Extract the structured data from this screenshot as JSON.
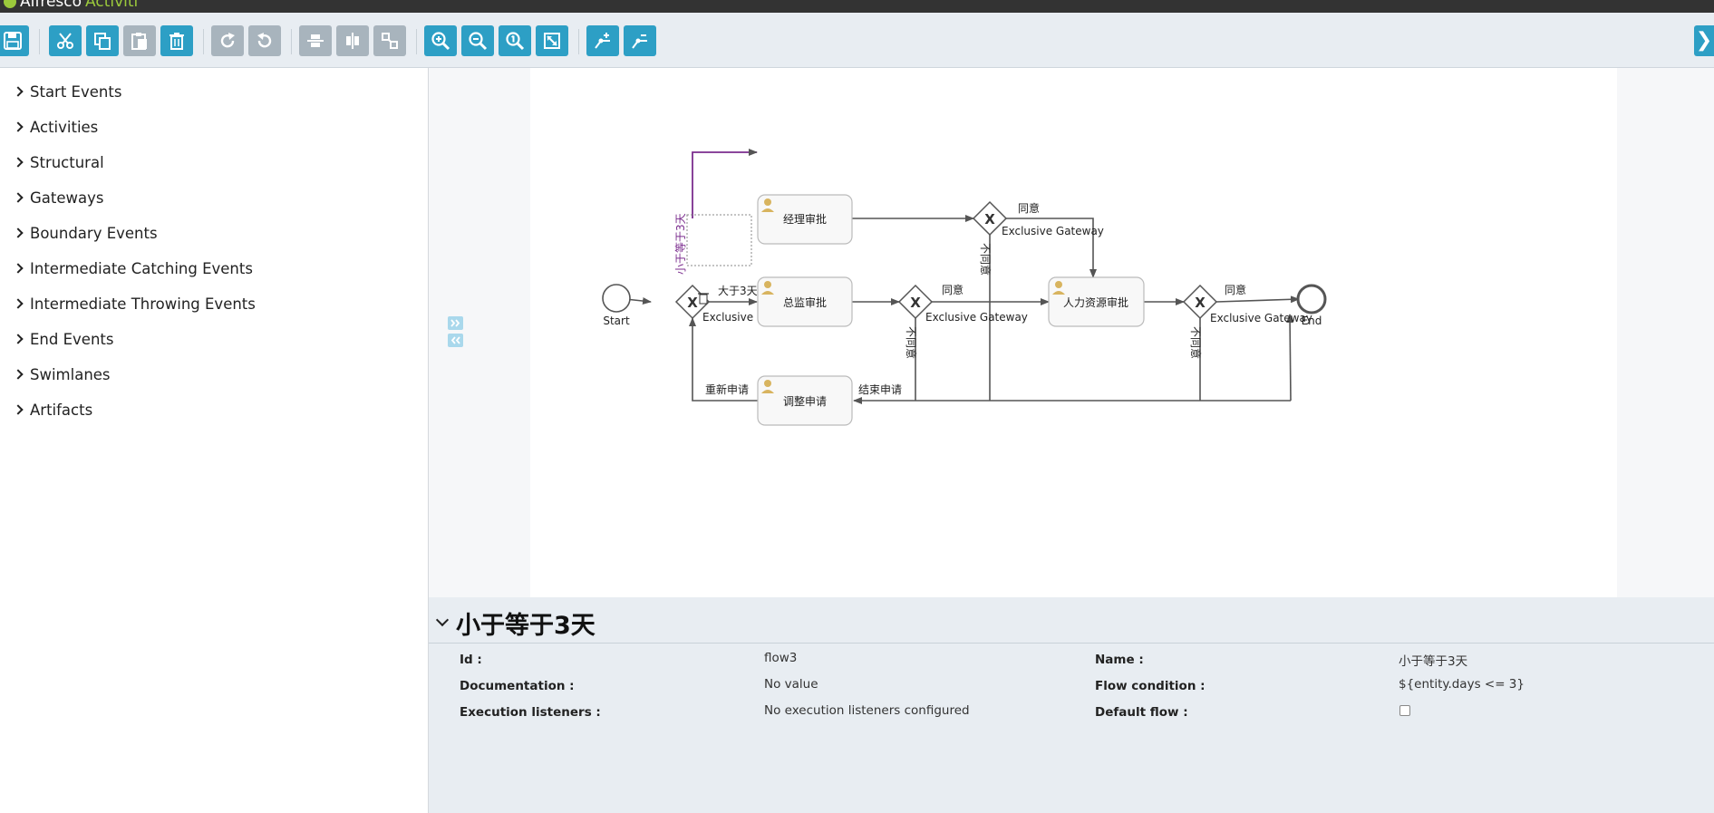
{
  "app": {
    "vendor": "Alfresco",
    "product": "Activiti"
  },
  "toolbar": {
    "buttons": [
      {
        "name": "save-button",
        "icon": "save-icon",
        "enabled": true
      },
      {
        "name": "cut-button",
        "icon": "scissors-icon",
        "enabled": true
      },
      {
        "name": "copy-button",
        "icon": "copy-icon",
        "enabled": true
      },
      {
        "name": "paste-button",
        "icon": "paste-icon",
        "enabled": false
      },
      {
        "name": "delete-button",
        "icon": "trash-icon",
        "enabled": true
      },
      {
        "name": "redo-button",
        "icon": "redo-icon",
        "enabled": false
      },
      {
        "name": "undo-button",
        "icon": "undo-icon",
        "enabled": false
      },
      {
        "name": "align-vertical-button",
        "icon": "align-vertical-icon",
        "enabled": false
      },
      {
        "name": "align-horizontal-button",
        "icon": "align-horizontal-icon",
        "enabled": false
      },
      {
        "name": "same-size-button",
        "icon": "same-size-icon",
        "enabled": false
      },
      {
        "name": "zoom-in-button",
        "icon": "zoom-in-icon",
        "enabled": true
      },
      {
        "name": "zoom-out-button",
        "icon": "zoom-out-icon",
        "enabled": true
      },
      {
        "name": "zoom-actual-button",
        "icon": "zoom-actual-icon",
        "enabled": true
      },
      {
        "name": "zoom-fit-button",
        "icon": "zoom-fit-icon",
        "enabled": true
      },
      {
        "name": "add-bendpoint-button",
        "icon": "add-bendpoint-icon",
        "enabled": true
      },
      {
        "name": "remove-bendpoint-button",
        "icon": "remove-bendpoint-icon",
        "enabled": true
      }
    ],
    "collapse_glyph": "❯"
  },
  "palette": {
    "items": [
      {
        "label": "Start Events"
      },
      {
        "label": "Activities"
      },
      {
        "label": "Structural"
      },
      {
        "label": "Gateways"
      },
      {
        "label": "Boundary Events"
      },
      {
        "label": "Intermediate Catching Events"
      },
      {
        "label": "Intermediate Throwing Events"
      },
      {
        "label": "End Events"
      },
      {
        "label": "Swimlanes"
      },
      {
        "label": "Artifacts"
      }
    ]
  },
  "diagram": {
    "start_label": "Start",
    "end_label": "End",
    "tasks": {
      "manager": "经理审批",
      "director": "总监审批",
      "hr": "人力资源审批",
      "adjust": "调整申请"
    },
    "gateways": {
      "g1": "Exclusive",
      "g2": "Exclusive Gateway",
      "g3": "Exclusive Gateway",
      "g4": "Exclusive Gateway"
    },
    "flows": {
      "le3": "小于等于3天",
      "gt3": "大于3天",
      "agree_top": "同意",
      "disagree_top": "不同意",
      "agree_mid": "同意",
      "disagree_mid": "不同意",
      "agree_right": "同意",
      "disagree_right": "不同意",
      "reapply": "重新申请",
      "end_apply": "结束申请"
    }
  },
  "properties": {
    "title": "小于等于3天",
    "id_label": "Id :",
    "id_value": "flow3",
    "doc_label": "Documentation :",
    "doc_value": "No value",
    "exec_label": "Execution listeners :",
    "exec_value": "No execution listeners configured",
    "name_label": "Name :",
    "name_value": "小于等于3天",
    "cond_label": "Flow condition :",
    "cond_value": "${entity.days <= 3}",
    "default_label": "Default flow :",
    "default_checked": false
  },
  "colors": {
    "accent": "#2d9fc5",
    "disabled": "#a8b4bd",
    "selection": "#7b2d8e",
    "panel_bg": "#e8edf2"
  }
}
